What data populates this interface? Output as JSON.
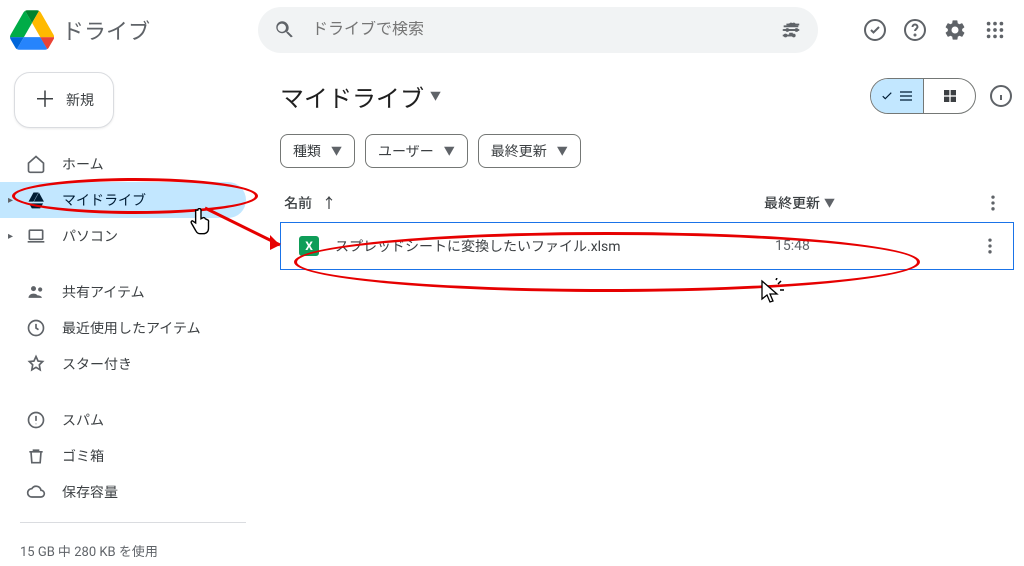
{
  "app_name": "ドライブ",
  "search_placeholder": "ドライブで検索",
  "new_button_label": "新規",
  "sidebar": {
    "items": [
      {
        "icon": "home",
        "label": "ホーム"
      },
      {
        "icon": "drive-solid",
        "label": "マイドライブ",
        "expandable": true,
        "active": true
      },
      {
        "icon": "laptop",
        "label": "パソコン",
        "expandable": true
      }
    ],
    "section2": [
      {
        "icon": "people",
        "label": "共有アイテム"
      },
      {
        "icon": "clock",
        "label": "最近使用したアイテム"
      },
      {
        "icon": "star",
        "label": "スター付き"
      }
    ],
    "section3": [
      {
        "icon": "spam",
        "label": "スパム"
      },
      {
        "icon": "trash",
        "label": "ゴミ箱"
      },
      {
        "icon": "cloud",
        "label": "保存容量"
      }
    ],
    "storage": "15 GB 中 280 KB を使用"
  },
  "page_title": "マイドライブ",
  "filters": {
    "type": "種類",
    "user": "ユーザー",
    "modified": "最終更新"
  },
  "columns": {
    "name": "名前",
    "modified": "最終更新"
  },
  "file": {
    "name": "スプレッドシートに変換したいファイル.xlsm",
    "modified": "15:48"
  }
}
